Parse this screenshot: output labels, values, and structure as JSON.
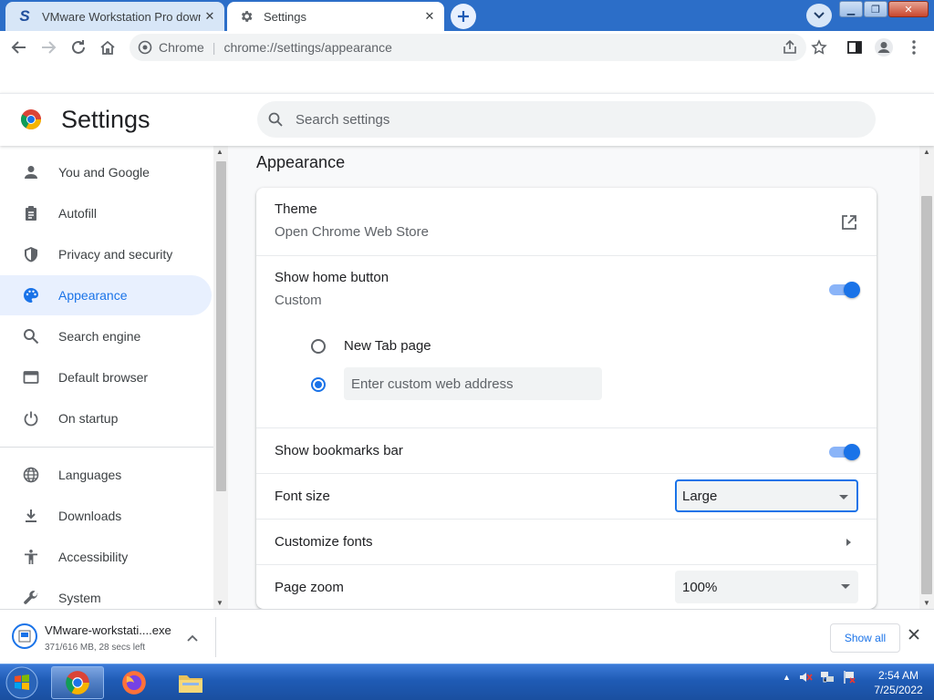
{
  "tabs": [
    {
      "title": "VMware Workstation Pro downlo",
      "favicon": "S"
    },
    {
      "title": "Settings"
    }
  ],
  "toolbar": {
    "site_label": "Chrome",
    "url_path": "chrome://settings/appearance"
  },
  "settings": {
    "title": "Settings",
    "search_placeholder": "Search settings"
  },
  "nav": {
    "items": [
      {
        "label": "You and Google",
        "icon": "person-icon"
      },
      {
        "label": "Autofill",
        "icon": "clipboard-icon"
      },
      {
        "label": "Privacy and security",
        "icon": "shield-icon"
      },
      {
        "label": "Appearance",
        "icon": "palette-icon",
        "selected": true
      },
      {
        "label": "Search engine",
        "icon": "search-icon"
      },
      {
        "label": "Default browser",
        "icon": "browser-window-icon"
      },
      {
        "label": "On startup",
        "icon": "power-icon"
      },
      {
        "label": "Languages",
        "icon": "globe-icon"
      },
      {
        "label": "Downloads",
        "icon": "download-icon"
      },
      {
        "label": "Accessibility",
        "icon": "accessibility-icon"
      },
      {
        "label": "System",
        "icon": "wrench-icon"
      }
    ]
  },
  "appearance": {
    "section_title": "Appearance",
    "theme": {
      "label": "Theme",
      "sub": "Open Chrome Web Store"
    },
    "home_button": {
      "label": "Show home button",
      "sub": "Custom",
      "enabled": true,
      "option_new_tab": "New Tab page",
      "custom_placeholder": "Enter custom web address",
      "selected_option": "custom"
    },
    "bookmarks_bar": {
      "label": "Show bookmarks bar",
      "enabled": true
    },
    "font_size": {
      "label": "Font size",
      "value": "Large"
    },
    "customize_fonts": {
      "label": "Customize fonts"
    },
    "page_zoom": {
      "label": "Page zoom",
      "value": "100%"
    }
  },
  "download": {
    "filename": "VMware-workstati....exe",
    "status": "371/616 MB, 28 secs left",
    "show_all": "Show all"
  },
  "taskbar": {
    "time": "2:54 AM",
    "date": "7/25/2022"
  },
  "colors": {
    "accent": "#1a73e8",
    "nav_selected_bg": "#e8f0fe",
    "tabstrip": "#2c6ec8"
  }
}
